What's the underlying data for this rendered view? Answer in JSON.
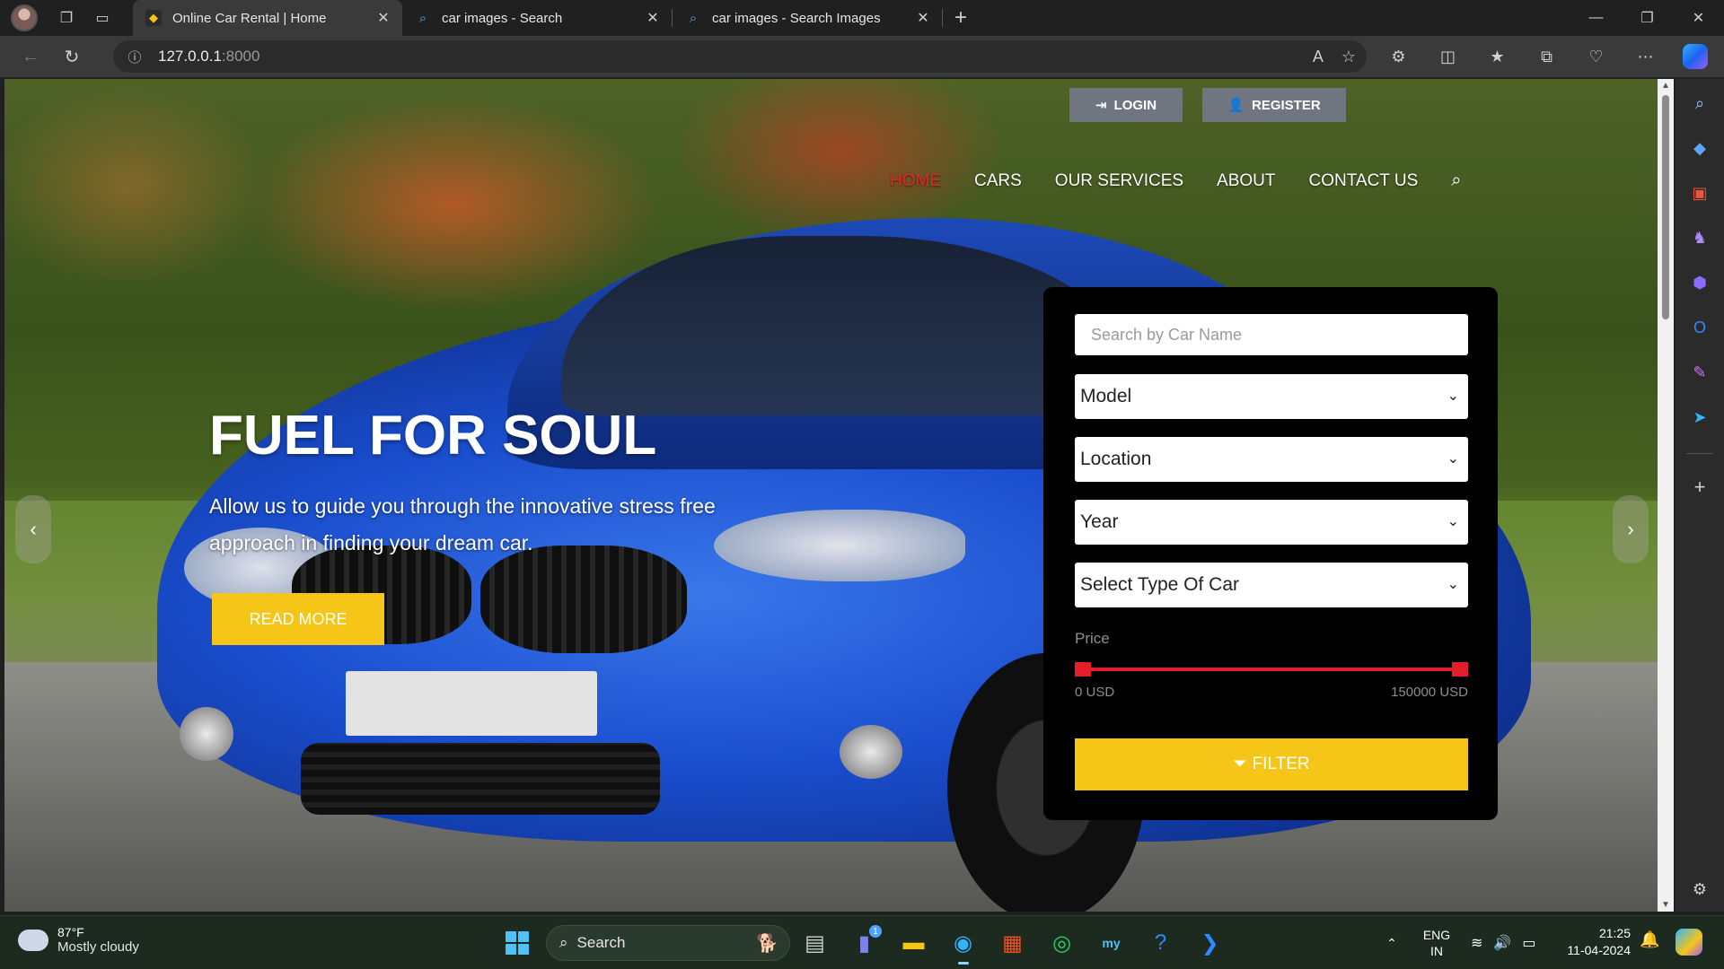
{
  "browser": {
    "tabs": [
      {
        "title": "Online Car Rental | Home",
        "active": true,
        "favicon": "site-logo-icon"
      },
      {
        "title": "car images - Search",
        "active": false,
        "favicon": "search-icon"
      },
      {
        "title": "car images - Search Images",
        "active": false,
        "favicon": "search-icon"
      }
    ],
    "url_host": "127.0.0.1",
    "url_port": ":8000"
  },
  "header": {
    "login_label": "LOGIN",
    "register_label": "REGISTER",
    "nav": [
      {
        "label": "HOME",
        "active": true
      },
      {
        "label": "CARS"
      },
      {
        "label": "OUR SERVICES"
      },
      {
        "label": "ABOUT"
      },
      {
        "label": "CONTACT US"
      }
    ]
  },
  "hero": {
    "title": "FUEL FOR SOUL",
    "text": "Allow us to guide you through the innovative stress free approach in finding your dream car.",
    "button": "READ MORE"
  },
  "filter": {
    "search_placeholder": "Search by Car Name",
    "selects": [
      "Model",
      "Location",
      "Year",
      "Select Type Of Car"
    ],
    "price_label": "Price",
    "price_min": "0 USD",
    "price_max": "150000 USD",
    "price_range_fraction": [
      0,
      1
    ],
    "button": "FILTER"
  },
  "colors": {
    "accent": "#f5c518",
    "nav_active": "#e52626",
    "slider": "#e31d2a"
  },
  "taskbar": {
    "temperature": "87°F",
    "condition": "Mostly cloudy",
    "search_label": "Search",
    "lang_top": "ENG",
    "lang_bottom": "IN",
    "time": "21:25",
    "date": "11-04-2024",
    "teams_badge": "1"
  }
}
